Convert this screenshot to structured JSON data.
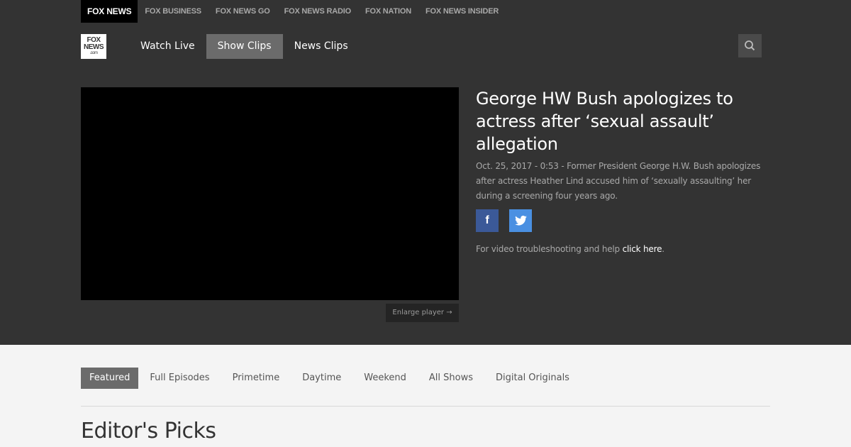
{
  "network_bar": {
    "items": [
      {
        "label": "FOX NEWS"
      },
      {
        "label": "FOX BUSINESS"
      },
      {
        "label": "FOX NEWS GO"
      },
      {
        "label": "FOX NEWS RADIO"
      },
      {
        "label": "FOX NATION"
      },
      {
        "label": "FOX NEWS INSIDER"
      }
    ]
  },
  "logo": {
    "line1": "FOX",
    "line2": "NEWS",
    "line3": ".com"
  },
  "nav": {
    "items": [
      {
        "label": "Watch Live"
      },
      {
        "label": "Show Clips"
      },
      {
        "label": "News Clips"
      }
    ],
    "active": "Show Clips",
    "search_icon": "search-icon"
  },
  "video": {
    "title": "George HW Bush apologizes to actress after ‘sexual assault’ allegation",
    "date": "Oct. 25, 2017 - 0:53",
    "description": "Former President George H.W. Bush apologizes after actress Heather Lind accused him of ‘sexually assaulting’ her during a screening four years ago.",
    "enlarge_label": "Enlarge player →",
    "help_text": "For video troubleshooting and help",
    "help_link": "click here",
    "help_suffix": "."
  },
  "social": {
    "facebook_glyph": "f",
    "twitter_glyph": "🐦"
  },
  "tabs": {
    "items": [
      {
        "label": "Featured"
      },
      {
        "label": "Full Episodes"
      },
      {
        "label": "Primetime"
      },
      {
        "label": "Daytime"
      },
      {
        "label": "Weekend"
      },
      {
        "label": "All Shows"
      },
      {
        "label": "Digital Originals"
      }
    ],
    "active": "Featured"
  },
  "section": {
    "title": "Editor's Picks"
  },
  "colors": {
    "topbar": "#333333",
    "facebook": "#3b5998",
    "twitter": "#4a90e2",
    "active_tab": "#6b6b6b"
  }
}
